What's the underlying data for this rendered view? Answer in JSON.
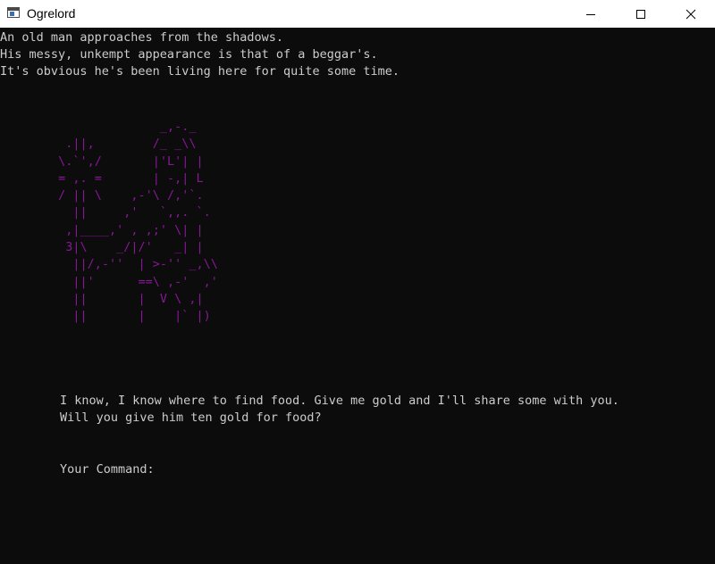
{
  "window": {
    "title": "Ogrelord",
    "icon": "console-app-icon",
    "controls": {
      "minimize_icon": "minimize-icon",
      "maximize_icon": "maximize-icon",
      "close_icon": "close-icon"
    }
  },
  "colors": {
    "background": "#0c0c0c",
    "text": "#cccccc",
    "art": "#881798",
    "titlebar": "#ffffff"
  },
  "narration": [
    "An old man approaches from the shadows.",
    "His messy, unkempt appearance is that of a beggar's.",
    "It's obvious he's been living here for quite some time."
  ],
  "ascii_art": "               _,-._\n  .||,        /_ _\\\\\n \\.`',/       |'L'| |\n = ,. =       | -,| L\n / || \\    ,-'\\ /,'`.\n   ||     ,'   `,,. `.\n  ,|____,' , ,;' \\| |\n  3|\\    _/|/'   _| |\n   ||/,-''  | >-'' _,\\\\\n   ||'      ==\\ ,-'  ,'\n   ||       |  V \\ ,|\n   ||       |    |` |)",
  "dialogue": [
    "I know, I know where to find food. Give me gold and I'll share some with you.",
    "Will you give him ten gold for food?"
  ],
  "prompt": "Your Command:"
}
